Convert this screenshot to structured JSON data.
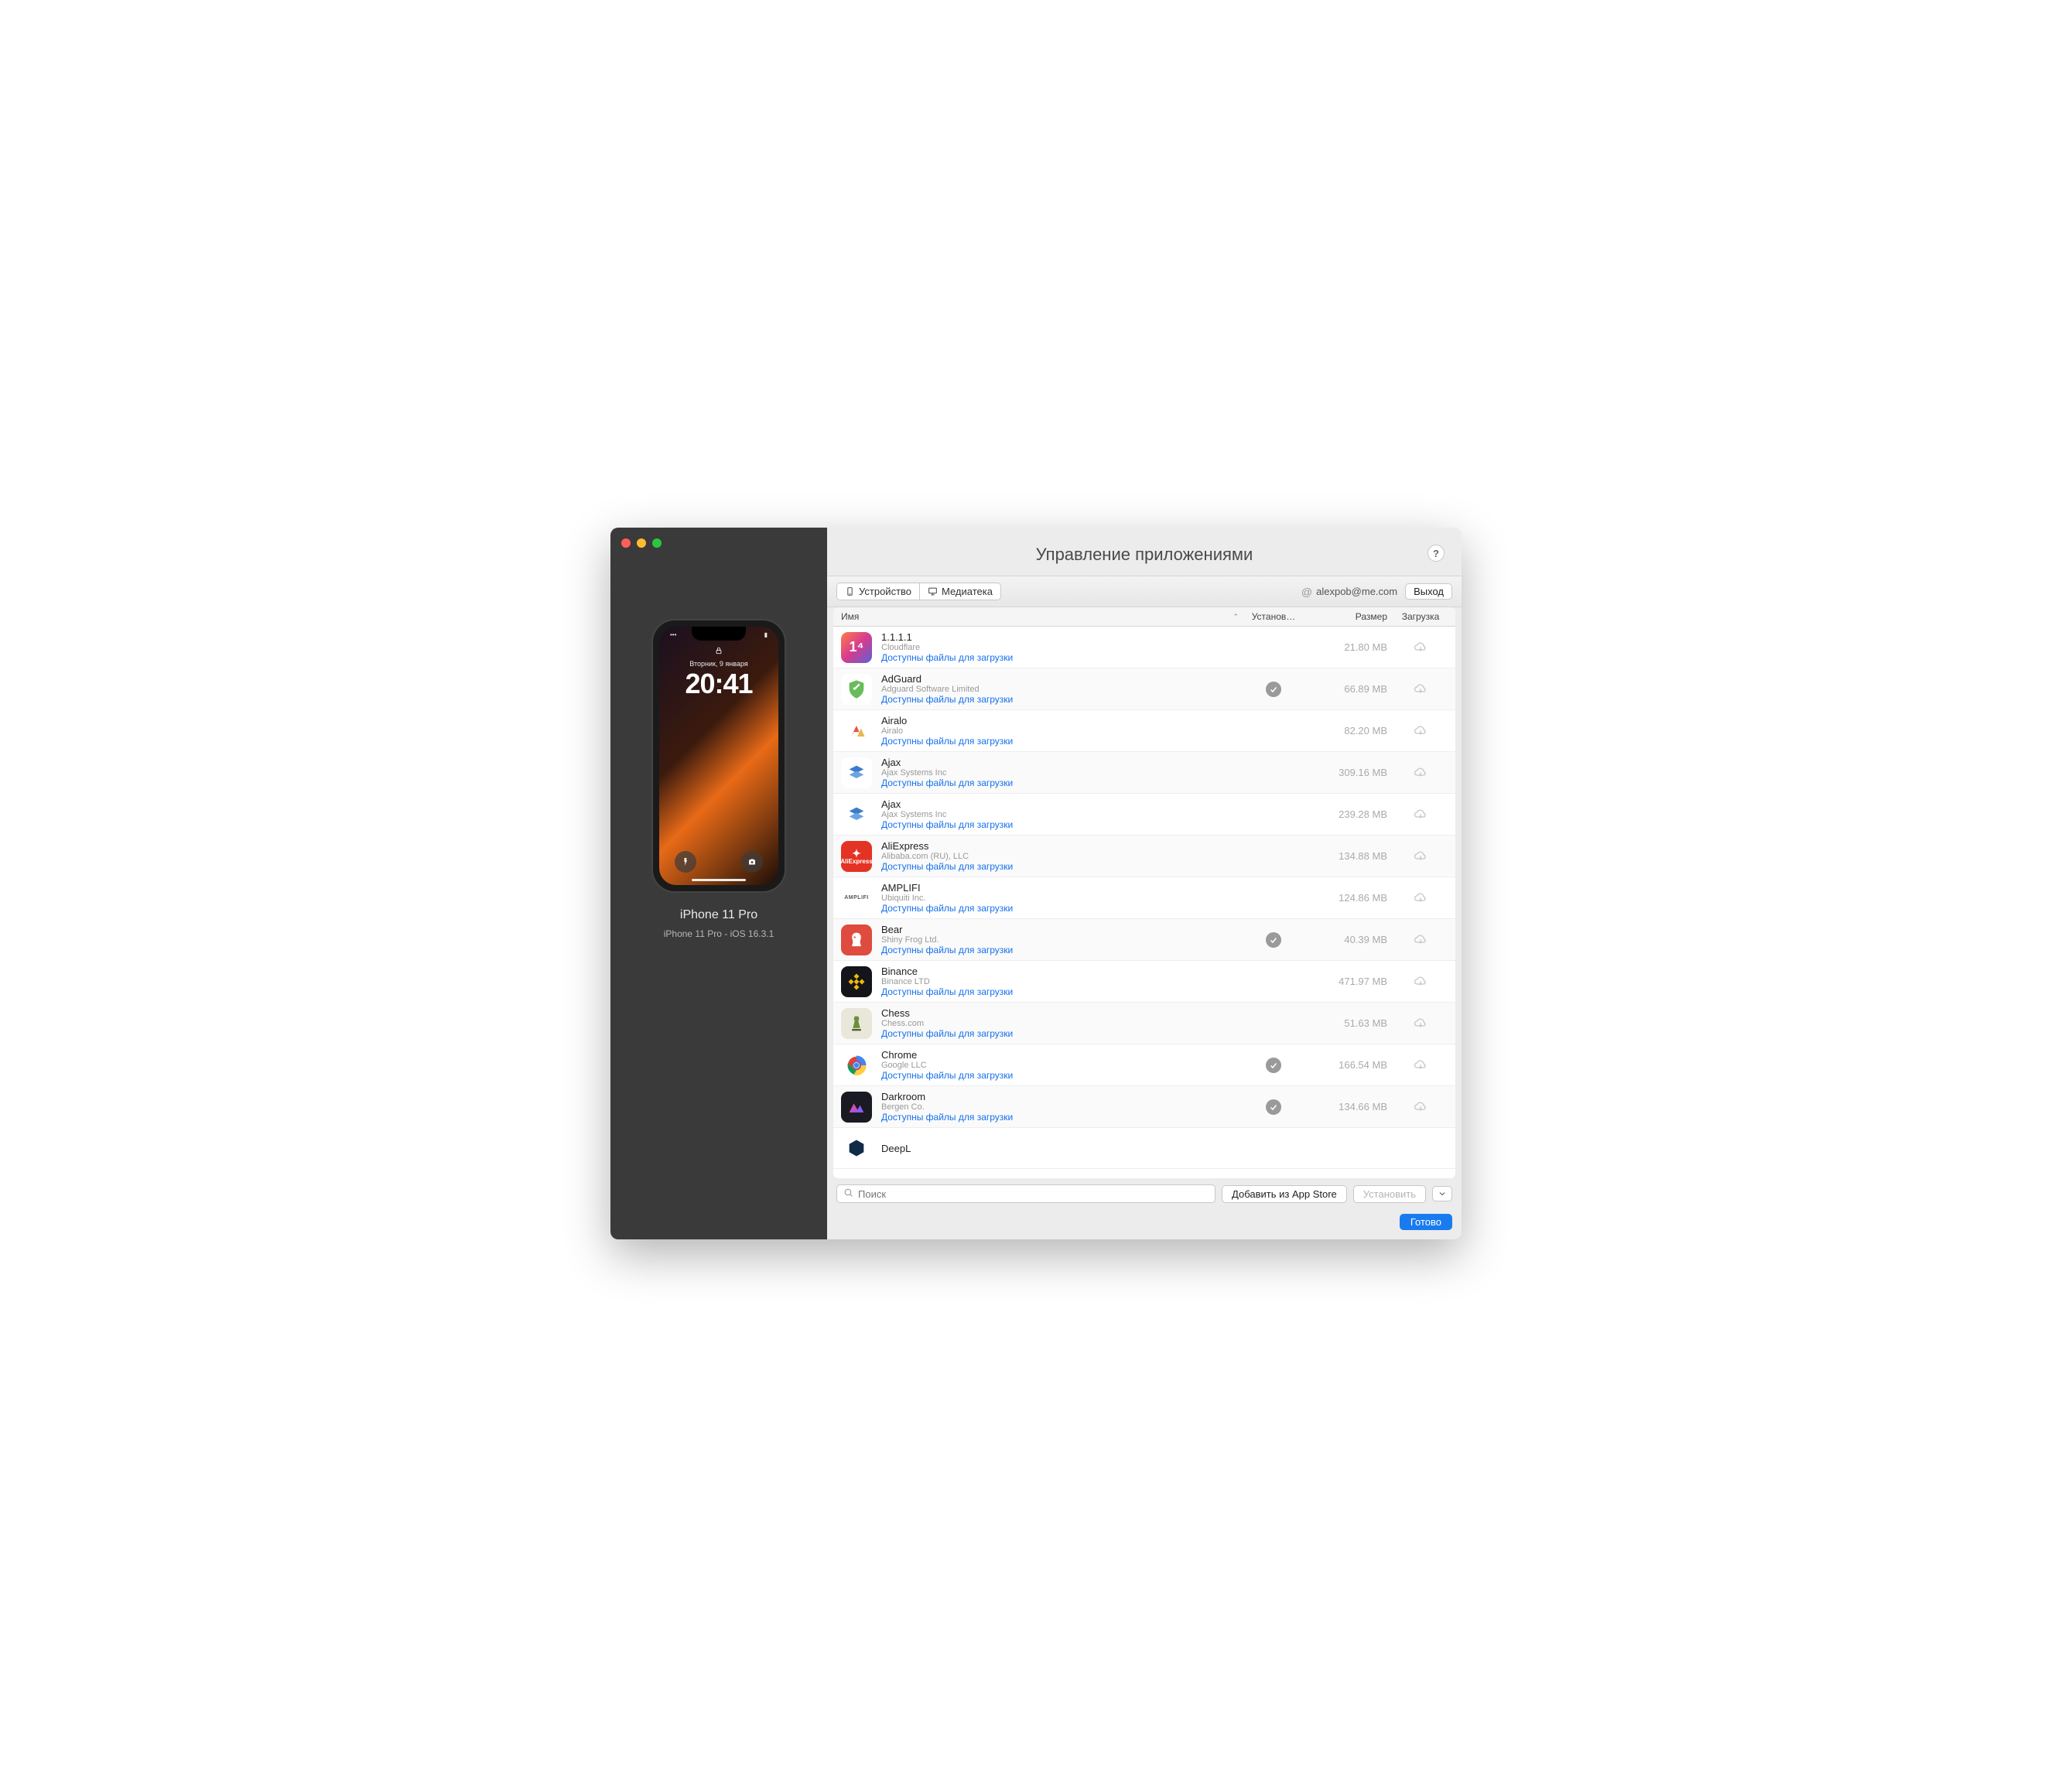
{
  "window": {
    "title": "Управление приложениями"
  },
  "sidebar": {
    "device_name": "iPhone 11 Pro",
    "device_sub": "iPhone 11 Pro - iOS 16.3.1",
    "phone": {
      "date": "Вторник, 9 января",
      "time": "20:41"
    }
  },
  "toolbar": {
    "tab_device": "Устройство",
    "tab_library": "Медиатека",
    "account_email": "alexpob@me.com",
    "logout": "Выход",
    "help": "?"
  },
  "table": {
    "col_name": "Имя",
    "col_installed": "Установ…",
    "col_size": "Размер",
    "col_download": "Загрузка",
    "download_link_text": "Доступны файлы для загрузки"
  },
  "apps": [
    {
      "name": "1.1.1.1",
      "developer": "Cloudflare",
      "size": "21.80 MB",
      "installed": false,
      "icon": "ic-1111"
    },
    {
      "name": "AdGuard",
      "developer": "Adguard Software Limited",
      "size": "66.89 MB",
      "installed": true,
      "icon": "ic-adguard"
    },
    {
      "name": "Airalo",
      "developer": "Airalo",
      "size": "82.20 MB",
      "installed": false,
      "icon": "ic-airalo"
    },
    {
      "name": "Ajax",
      "developer": "Ajax Systems Inc",
      "size": "309.16 MB",
      "installed": false,
      "icon": "ic-ajax"
    },
    {
      "name": "Ajax",
      "developer": "Ajax Systems Inc",
      "size": "239.28 MB",
      "installed": false,
      "icon": "ic-ajax"
    },
    {
      "name": "AliExpress",
      "developer": "Alibaba.com (RU), LLC",
      "size": "134.88 MB",
      "installed": false,
      "icon": "ic-aliexpress"
    },
    {
      "name": "AMPLIFI",
      "developer": "Ubiquiti Inc.",
      "size": "124.86 MB",
      "installed": false,
      "icon": "ic-amplifi"
    },
    {
      "name": "Bear",
      "developer": "Shiny Frog Ltd.",
      "size": "40.39 MB",
      "installed": true,
      "icon": "ic-bear"
    },
    {
      "name": "Binance",
      "developer": "Binance LTD",
      "size": "471.97 MB",
      "installed": false,
      "icon": "ic-binance"
    },
    {
      "name": "Chess",
      "developer": "Chess.com",
      "size": "51.63 MB",
      "installed": false,
      "icon": "ic-chess"
    },
    {
      "name": "Chrome",
      "developer": "Google LLC",
      "size": "166.54 MB",
      "installed": true,
      "icon": "ic-chrome"
    },
    {
      "name": "Darkroom",
      "developer": "Bergen Co.",
      "size": "134.66 MB",
      "installed": true,
      "icon": "ic-darkroom"
    },
    {
      "name": "DeepL",
      "developer": "",
      "size": "",
      "installed": false,
      "icon": "ic-deepl"
    }
  ],
  "bottombar": {
    "search_placeholder": "Поиск",
    "add_from_store": "Добавить из App Store",
    "install": "Установить"
  },
  "footer": {
    "done": "Готово"
  }
}
